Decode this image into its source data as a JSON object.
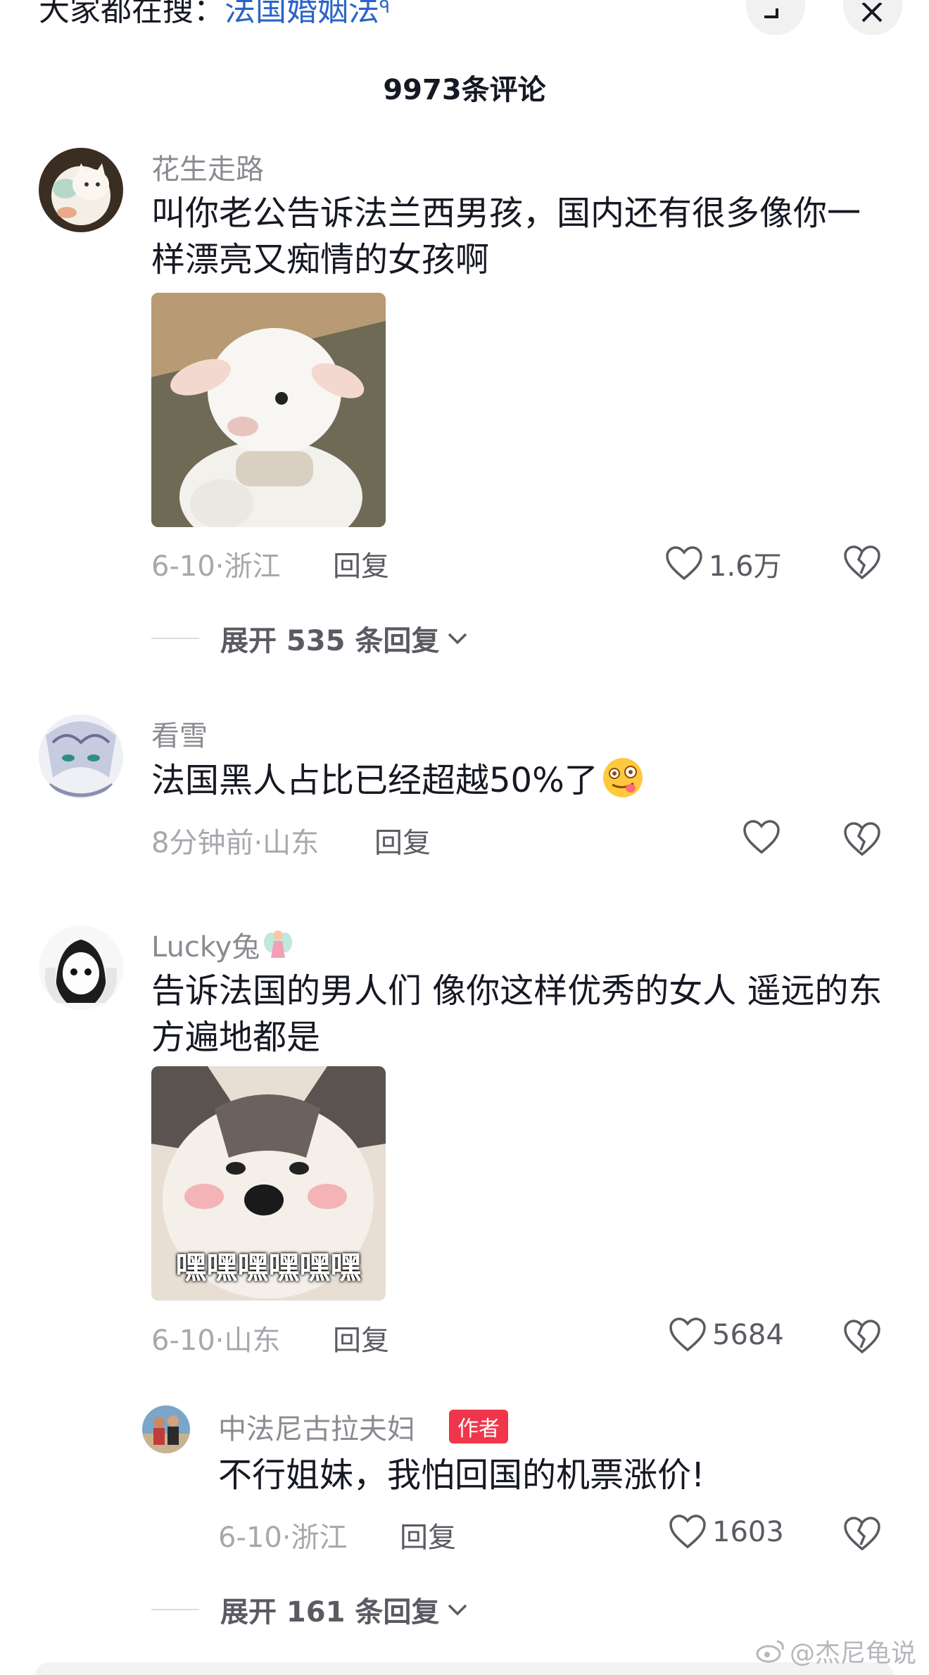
{
  "search": {
    "prefix": "大家都在搜：",
    "keyword": "法国婚姻法"
  },
  "header": {
    "comment_count": "9973条评论"
  },
  "comments": [
    {
      "username": "花生走路",
      "text": "叫你老公告诉法兰西男孩，国内还有很多像你一样漂亮又痴情的女孩啊",
      "meta": "6-10·浙江",
      "reply_label": "回复",
      "likes": "1.6万",
      "sticker": "lamb-sticker",
      "expand_label": "展开 535 条回复"
    },
    {
      "username": "看雪",
      "text": "法国黑人占比已经超越50%了",
      "meta": "8分钟前·山东",
      "reply_label": "回复",
      "likes": ""
    },
    {
      "username": "Lucky兔",
      "text": "告诉法国的男人们 像你这样优秀的女人 遥远的东方遍地都是",
      "meta": "6-10·山东",
      "reply_label": "回复",
      "likes": "5684",
      "sticker": "husky-sticker",
      "sticker_caption": "嘿嘿嘿嘿嘿嘿",
      "reply": {
        "username": "中法尼古拉夫妇",
        "badge": "作者",
        "text": "不行姐妹，我怕回国的机票涨价!",
        "meta": "6-10·浙江",
        "reply_label": "回复",
        "likes": "1603"
      },
      "expand_label": "展开 161 条回复"
    }
  ],
  "watermark": "@杰尼龟说",
  "colors": {
    "link": "#2a64c8",
    "badge": "#f0364a",
    "muted": "#a7a8ad"
  }
}
